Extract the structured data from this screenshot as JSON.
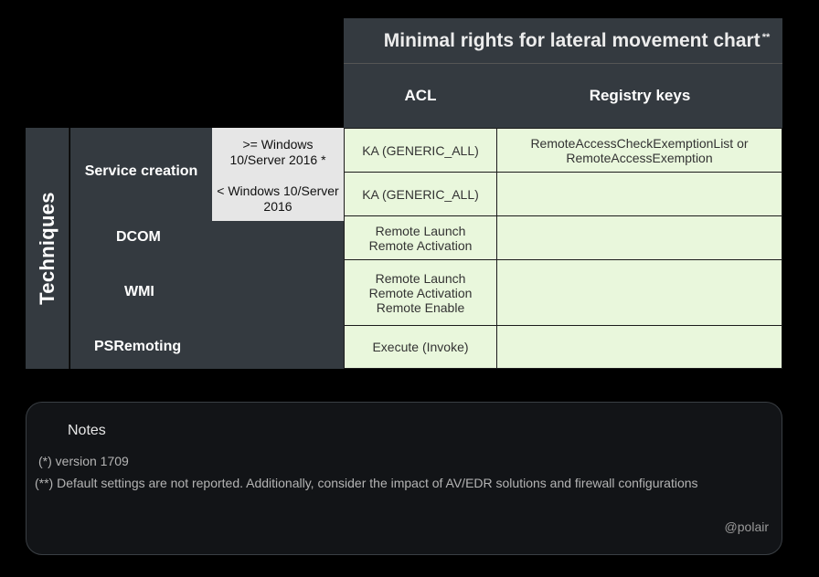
{
  "title": "Minimal rights for lateral movement chart",
  "title_mark": "**",
  "columns": {
    "acl": "ACL",
    "registry": "Registry keys"
  },
  "axis_label": "Techniques",
  "techniques": {
    "service_creation": "Service creation",
    "dcom": "DCOM",
    "wmi": "WMI",
    "psremoting": "PSRemoting"
  },
  "versions": {
    "new": ">= Windows 10/Server 2016 *",
    "old": "< Windows 10/Server 2016"
  },
  "cells": {
    "svc_new_acl": "KA (GENERIC_ALL)",
    "svc_new_reg": "RemoteAccessCheckExemptionList or RemoteAccessExemption",
    "svc_old_acl": "KA (GENERIC_ALL)",
    "svc_old_reg": "",
    "dcom_acl_1": "Remote Launch",
    "dcom_acl_2": "Remote Activation",
    "dcom_reg": "",
    "wmi_acl_1": "Remote Launch",
    "wmi_acl_2": "Remote Activation",
    "wmi_acl_3": "Remote Enable",
    "wmi_reg": "",
    "ps_acl": "Execute (Invoke)",
    "ps_reg": ""
  },
  "notes": {
    "title": "Notes",
    "note1": "(*) version 1709",
    "note2": "(**) Default settings are not reported. Additionally, consider the impact of AV/EDR solutions and firewall configurations",
    "credit": "@polair"
  },
  "colors": {
    "background": "#000000",
    "header": "#343a40",
    "cell_green": "#e9f7dc",
    "cell_gray": "#e6e6e6"
  }
}
